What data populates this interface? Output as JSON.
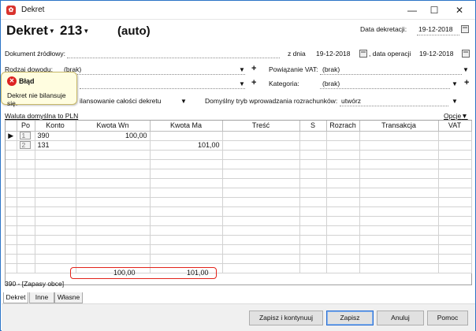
{
  "window": {
    "title": "Dekret",
    "app_icon_color": "#d9332e"
  },
  "header": {
    "doc_type": "Dekret",
    "number": "213",
    "mode": "(auto)",
    "data_dekretacji_label": "Data dekretacji:",
    "data_dekretacji_value": "19-12-2018"
  },
  "form": {
    "dokument_zrodlowy_label": "Dokument źródłowy:",
    "z_dnia_label": "z dnia",
    "z_dnia_value": "19-12-2018",
    "data_operacji_label": ", data operacji",
    "data_operacji_value": "19-12-2018",
    "rodzaj_dowodu_label": "Rodzaj dowodu:",
    "rodzaj_dowodu_value": "(brak)",
    "powiazanie_vat_label": "Powiązanie VAT:",
    "powiazanie_vat_value": "(brak)",
    "kategoria_label": "Kategoria:",
    "kategoria_value": "(brak)",
    "bilansowanie_label": "ilansowanie całości dekretu",
    "tryb_label": "Domyślny tryb wprowadzania rozrachunków:",
    "tryb_value": "utwórz",
    "waluta_link": "Waluta domyślna to PLN",
    "opcje_link": "Opcje"
  },
  "tooltip": {
    "title": "Błąd",
    "message": "Dekret nie bilansuje się.",
    "icon": "error-icon"
  },
  "grid": {
    "columns": [
      "Po",
      "Konto",
      "Kwota Wn",
      "Kwota Ma",
      "Treść",
      "S",
      "Rozrach",
      "Transakcja",
      "VAT"
    ],
    "rows": [
      {
        "po": "1",
        "konto": "390",
        "wn": "100,00",
        "ma": "",
        "tresc": "",
        "s": "",
        "rozrach": "",
        "transakcja": "",
        "vat": ""
      },
      {
        "po": "2",
        "konto": "131",
        "wn": "",
        "ma": "101,00",
        "tresc": "",
        "s": "",
        "rozrach": "",
        "transakcja": "",
        "vat": ""
      }
    ],
    "sum_wn": "100,00",
    "sum_ma": "101,00",
    "highlight_color": "#e2231a"
  },
  "status_line": "390 - [Zapasy obce]",
  "tabs": [
    "Dekret",
    "Inne",
    "Własne"
  ],
  "buttons": {
    "save_continue": "Zapisz i kontynuuj",
    "save": "Zapisz",
    "cancel": "Anuluj",
    "help": "Pomoc"
  }
}
